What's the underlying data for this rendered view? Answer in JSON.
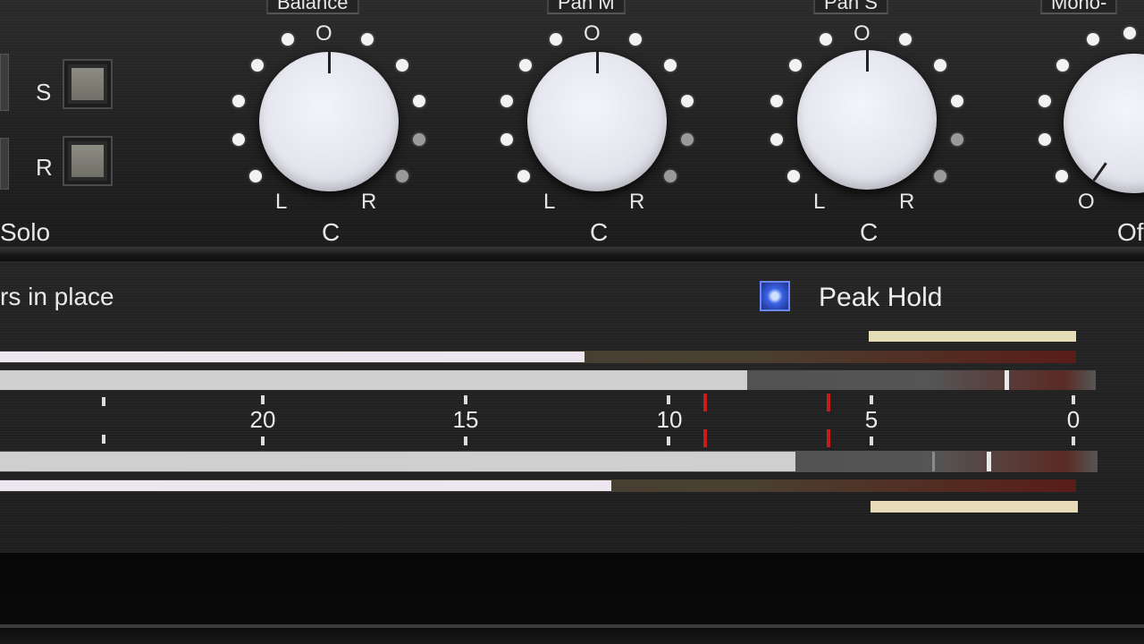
{
  "knobs": [
    {
      "header": "Balance",
      "top": "O",
      "left": "L",
      "right": "R",
      "bottom": "C"
    },
    {
      "header": "Pan M",
      "top": "O",
      "left": "L",
      "right": "R",
      "bottom": "C"
    },
    {
      "header": "Pan S",
      "top": "O",
      "left": "L",
      "right": "R",
      "bottom": "C"
    },
    {
      "header": "Mono-",
      "bottom_left": "O",
      "bottom": "Of"
    }
  ],
  "solo": {
    "s_label": "S",
    "r_label": "R",
    "section_label": "Solo"
  },
  "meters": {
    "left_text": "rs in place",
    "peak_hold_label": "Peak Hold",
    "peak_hold_checked": true,
    "scale": [
      "20",
      "15",
      "10",
      "5",
      "0"
    ],
    "levels": {
      "ch1_rms": 0.51,
      "ch1_peak": 0.65,
      "ch2_peak": 0.7,
      "ch2_rms": 0.53
    }
  },
  "colors": {
    "accent_blue": "#3a63e6",
    "red_marker": "#c41d1d",
    "peak_bar": "#e7dcb8"
  }
}
